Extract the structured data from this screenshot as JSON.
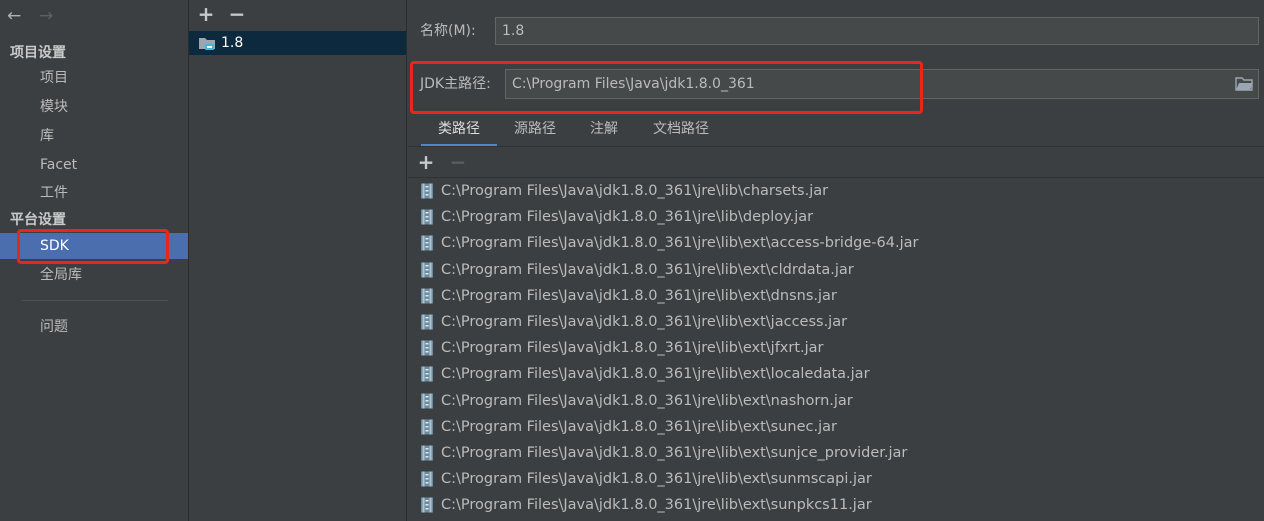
{
  "nav": {
    "back_icon": "arrow-left-icon",
    "forward_icon": "arrow-right-icon",
    "section_project": "项目设置",
    "project_items": [
      "项目",
      "模块",
      "库",
      "Facet",
      "工件"
    ],
    "section_platform": "平台设置",
    "platform_items": [
      "SDK",
      "全局库"
    ],
    "problems": "问题"
  },
  "sdk_list": {
    "add_icon": "plus-icon",
    "remove_icon": "minus-icon",
    "selected_sdk": "1.8"
  },
  "detail": {
    "name_label": "名称(M):",
    "name_value": "1.8",
    "home_label": "JDK主路径:",
    "home_value": "C:\\Program Files\\Java\\jdk1.8.0_361",
    "tabs": [
      "类路径",
      "源路径",
      "注解",
      "文档路径"
    ],
    "active_tab": "类路径",
    "classpath": [
      "C:\\Program Files\\Java\\jdk1.8.0_361\\jre\\lib\\charsets.jar",
      "C:\\Program Files\\Java\\jdk1.8.0_361\\jre\\lib\\deploy.jar",
      "C:\\Program Files\\Java\\jdk1.8.0_361\\jre\\lib\\ext\\access-bridge-64.jar",
      "C:\\Program Files\\Java\\jdk1.8.0_361\\jre\\lib\\ext\\cldrdata.jar",
      "C:\\Program Files\\Java\\jdk1.8.0_361\\jre\\lib\\ext\\dnsns.jar",
      "C:\\Program Files\\Java\\jdk1.8.0_361\\jre\\lib\\ext\\jaccess.jar",
      "C:\\Program Files\\Java\\jdk1.8.0_361\\jre\\lib\\ext\\jfxrt.jar",
      "C:\\Program Files\\Java\\jdk1.8.0_361\\jre\\lib\\ext\\localedata.jar",
      "C:\\Program Files\\Java\\jdk1.8.0_361\\jre\\lib\\ext\\nashorn.jar",
      "C:\\Program Files\\Java\\jdk1.8.0_361\\jre\\lib\\ext\\sunec.jar",
      "C:\\Program Files\\Java\\jdk1.8.0_361\\jre\\lib\\ext\\sunjce_provider.jar",
      "C:\\Program Files\\Java\\jdk1.8.0_361\\jre\\lib\\ext\\sunmscapi.jar",
      "C:\\Program Files\\Java\\jdk1.8.0_361\\jre\\lib\\ext\\sunpkcs11.jar"
    ]
  },
  "colors": {
    "background": "#3c3f41",
    "selection": "#4b6eaf",
    "highlight_box": "#e8271c",
    "tab_underline": "#4a88c7"
  }
}
